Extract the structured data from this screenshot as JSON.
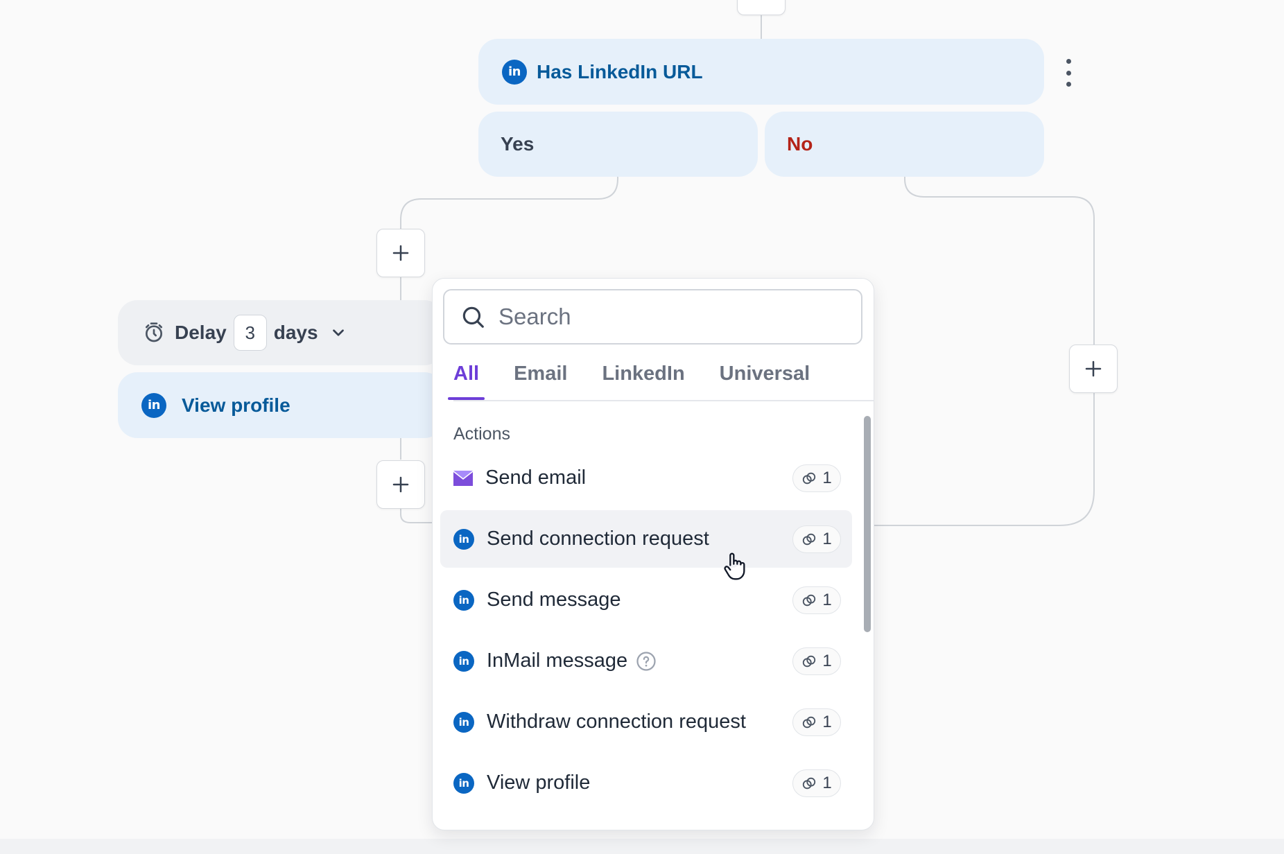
{
  "condition_node": {
    "title": "Has LinkedIn URL",
    "icon": "linkedin-icon"
  },
  "branches": {
    "yes_label": "Yes",
    "no_label": "No"
  },
  "delay_node": {
    "label": "Delay",
    "value": "3",
    "unit": "days"
  },
  "view_profile_node": {
    "label": "View profile",
    "icon": "linkedin-icon"
  },
  "picker": {
    "search": {
      "placeholder": "Search",
      "value": ""
    },
    "tabs": [
      {
        "label": "All",
        "active": true
      },
      {
        "label": "Email",
        "active": false
      },
      {
        "label": "LinkedIn",
        "active": false
      },
      {
        "label": "Universal",
        "active": false
      }
    ],
    "section_title": "Actions",
    "items": [
      {
        "label": "Send email",
        "icon": "email-icon",
        "credits": "1"
      },
      {
        "label": "Send connection request",
        "icon": "linkedin-icon",
        "credits": "1",
        "hovered": true
      },
      {
        "label": "Send message",
        "icon": "linkedin-icon",
        "credits": "1"
      },
      {
        "label": "InMail message",
        "icon": "linkedin-icon",
        "credits": "1",
        "help": true
      },
      {
        "label": "Withdraw connection request",
        "icon": "linkedin-icon",
        "credits": "1"
      },
      {
        "label": "View profile",
        "icon": "linkedin-icon",
        "credits": "1"
      }
    ]
  },
  "colors": {
    "linkedin_blue": "#0a66c2",
    "node_blue_bg": "#e6f0fa",
    "no_red": "#b42318",
    "active_tab_purple": "#6d3ed8",
    "email_icon_purple": "#7c4ddb"
  }
}
